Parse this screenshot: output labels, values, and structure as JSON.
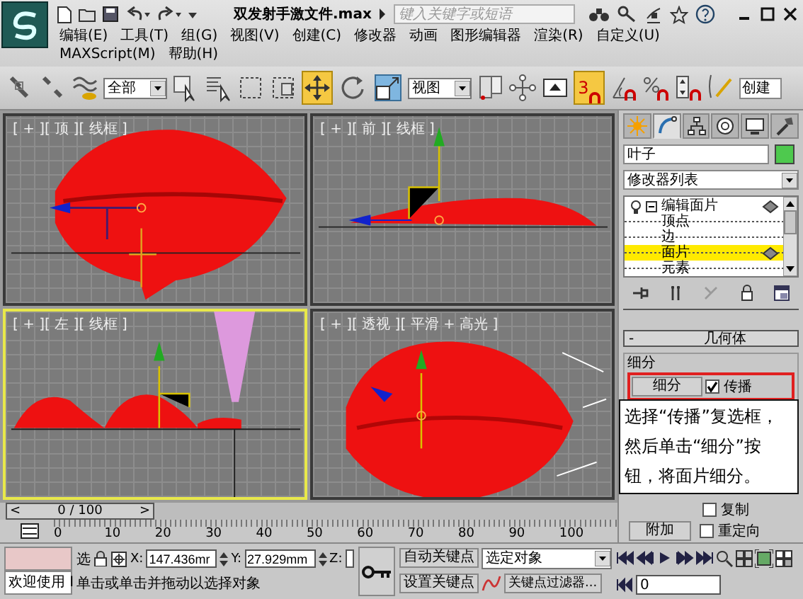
{
  "window": {
    "title": "双发射手激文件.max",
    "search_placeholder": "键入关键字或短语"
  },
  "menu": [
    "编辑(E)",
    "工具(T)",
    "组(G)",
    "视图(V)",
    "创建(C)",
    "修改器",
    "动画",
    "图形编辑器",
    "渲染(R)",
    "自定义(U)",
    "MAXScript(M)",
    "帮助(H)"
  ],
  "toolbar": {
    "selection_filter": "全部",
    "move_tool": {
      "selected": true
    },
    "rotate_tool": {
      "selected": false
    },
    "scale_tool": {
      "selected": false
    },
    "coordinate_system": "视图",
    "snap_toggle": {
      "label": "3",
      "on": true
    },
    "named_selection": "创建"
  },
  "viewports": [
    {
      "kind": "top",
      "label": "[ + ][ 顶 ][ 线框 ]",
      "active": false
    },
    {
      "kind": "front",
      "label": "[ + ][ 前 ][ 线框 ]",
      "active": false
    },
    {
      "kind": "left",
      "label": "[ + ][ 左 ][ 线框 ]",
      "active": true
    },
    {
      "kind": "perspective",
      "label": "[ + ][ 透视 ][ 平滑 + 高光 ]",
      "active": false
    }
  ],
  "time_slider": {
    "position": "0 / 100",
    "prev": "<",
    "next": ">"
  },
  "ruler": [
    "0",
    "10",
    "20",
    "30",
    "40",
    "50",
    "60",
    "70",
    "80",
    "90",
    "100"
  ],
  "command_panel": {
    "tabs": [
      {
        "selected": false
      },
      {
        "selected": true
      },
      {
        "selected": false
      },
      {
        "selected": false
      },
      {
        "selected": false
      },
      {
        "selected": false
      }
    ],
    "object_name": "叶子",
    "modifier_list": "修改器列表",
    "stack": [
      {
        "label": "编辑面片",
        "expanded": true,
        "selected": false,
        "children": [
          {
            "label": "顶点",
            "selected": false
          },
          {
            "label": "边",
            "selected": false
          },
          {
            "label": "面片",
            "selected": true
          },
          {
            "label": "元素",
            "selected": false
          }
        ]
      }
    ],
    "rollout": {
      "toggle": "-",
      "title": "几何体",
      "group": "细分",
      "button": "细分",
      "propagate": {
        "label": "传播",
        "checked": true
      },
      "highlighted": true
    },
    "copy": {
      "label": "复制",
      "checked": false
    },
    "attach_button": "附加",
    "reorient": {
      "label": "重定向",
      "checked": false
    }
  },
  "callout": {
    "text": "选择“传播”复选框，然后单击“细分”按钮，将面片细分。"
  },
  "status_bar": {
    "welcome": "欢迎使用 I",
    "selection_label": "选",
    "x": "147.436mr",
    "y": "27.929mm",
    "z_label": "Z:",
    "x_label": "X:",
    "y_label": "Y:",
    "prompt": "单击或单击并拖动以选择对象",
    "auto_key": "自动关键点",
    "set_key": "设置关键点",
    "key_target": "选定对象",
    "key_filters": "关键点过滤器...",
    "frame": "0"
  }
}
